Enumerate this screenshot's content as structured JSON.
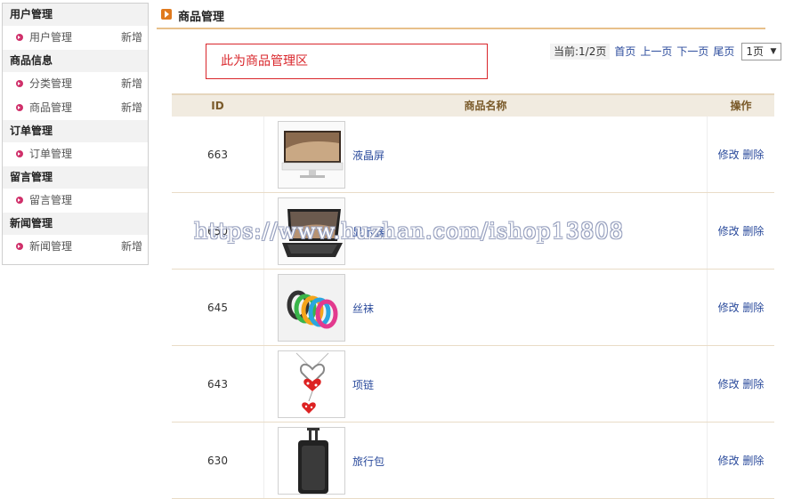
{
  "sidebar": {
    "groups": [
      {
        "title": "用户管理",
        "items": [
          {
            "label": "用户管理",
            "action": "新增"
          }
        ]
      },
      {
        "title": "商品信息",
        "items": [
          {
            "label": "分类管理",
            "action": "新增"
          },
          {
            "label": "商品管理",
            "action": "新增"
          }
        ]
      },
      {
        "title": "订单管理",
        "items": [
          {
            "label": "订单管理",
            "action": ""
          }
        ]
      },
      {
        "title": "留言管理",
        "items": [
          {
            "label": "留言管理",
            "action": ""
          }
        ]
      },
      {
        "title": "新闻管理",
        "items": [
          {
            "label": "新闻管理",
            "action": "新增"
          }
        ]
      }
    ]
  },
  "main": {
    "title": "商品管理",
    "notice": "此为商品管理区",
    "pager": {
      "current": "当前:1/2页",
      "first": "首页",
      "prev": "上一页",
      "next": "下一页",
      "last": "尾页",
      "select_value": "1页"
    },
    "table": {
      "headers": [
        "ID",
        "商品名称",
        "操作"
      ],
      "edit_label": "修改",
      "delete_label": "删除",
      "rows": [
        {
          "id": "663",
          "name": "液晶屏"
        },
        {
          "id": "650",
          "name": "显示器"
        },
        {
          "id": "645",
          "name": "丝袜"
        },
        {
          "id": "643",
          "name": "项链"
        },
        {
          "id": "630",
          "name": "旅行包"
        }
      ]
    }
  },
  "watermark": "https://www.huzhan.com/ishop13808",
  "colors": {
    "accent": "#e07a1e",
    "link": "#2b4b9c",
    "notice_border": "#d9262b",
    "bullet": "#d0306a"
  }
}
